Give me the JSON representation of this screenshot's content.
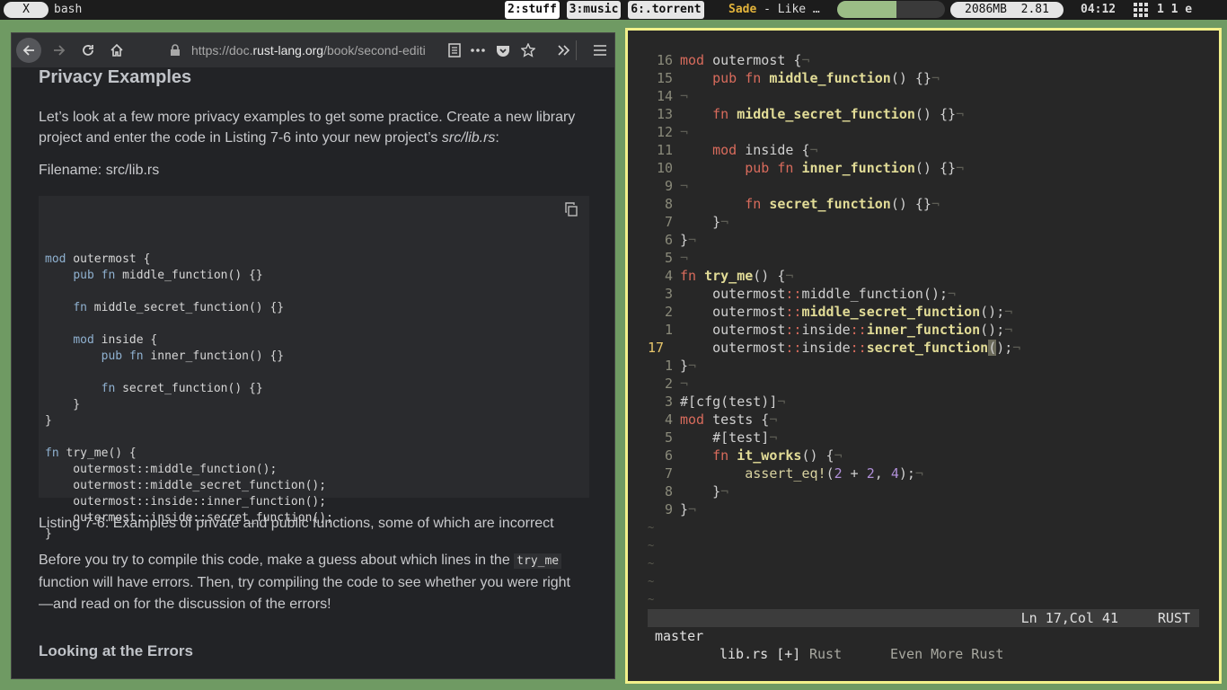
{
  "topbar": {
    "close_label": "X",
    "terminal_title": "bash",
    "workspaces": [
      {
        "label": "2:stuff"
      },
      {
        "label": "3:music"
      },
      {
        "label": "6:.torrent"
      }
    ],
    "music_artist": "Sade",
    "music_track": "- Like …",
    "music_progress": 0.55,
    "memory": "2086MB",
    "load": "2.81",
    "clock": "04:12",
    "tags": "1 1 e"
  },
  "browser": {
    "url_prefix": "https://doc.",
    "url_domain": "rust-lang.org",
    "url_path": "/book/second-editi",
    "heading": "Privacy Examples",
    "intro_text": "Let’s look at a few more privacy examples to get some practice. Create a new library project and enter the code in Listing 7-6 into your new project’s ",
    "intro_file": "src/lib.rs",
    "intro_end": ":",
    "filename_label": "Filename: src/lib.rs",
    "code_lines": [
      "mod outermost {",
      "    pub fn middle_function() {}",
      "",
      "    fn middle_secret_function() {}",
      "",
      "    mod inside {",
      "        pub fn inner_function() {}",
      "",
      "        fn secret_function() {}",
      "    }",
      "}",
      "",
      "fn try_me() {",
      "    outermost::middle_function();",
      "    outermost::middle_secret_function();",
      "    outermost::inside::inner_function();",
      "    outermost::inside::secret_function();",
      "}"
    ],
    "caption": "Listing 7-6: Examples of private and public functions, some of which are incorrect",
    "before_1": "Before you try to compile this code, make a guess about which lines in the ",
    "before_code": "try_me",
    "before_2": " function will have errors. Then, try compiling the code to see whether you were right—and read on for the discussion of the errors!",
    "heading2": "Looking at the Errors"
  },
  "editor": {
    "lines": [
      {
        "ln": "16",
        "html": "<span class='e-kw'>mod</span> outermost {"
      },
      {
        "ln": "15",
        "html": "    <span class='e-kw'>pub fn</span> <span class='e-fn'>middle_function</span>() {}"
      },
      {
        "ln": "14",
        "html": ""
      },
      {
        "ln": "13",
        "html": "    <span class='e-kw'>fn</span> <span class='e-fn'>middle_secret_function</span>() {}"
      },
      {
        "ln": "12",
        "html": ""
      },
      {
        "ln": "11",
        "html": "    <span class='e-kw'>mod</span> inside {"
      },
      {
        "ln": "10",
        "html": "        <span class='e-kw'>pub fn</span> <span class='e-fn'>inner_function</span>() {}"
      },
      {
        "ln": "9",
        "html": ""
      },
      {
        "ln": "8",
        "html": "        <span class='e-kw'>fn</span> <span class='e-fn'>secret_function</span>() {}"
      },
      {
        "ln": "7",
        "html": "    }"
      },
      {
        "ln": "6",
        "html": "}"
      },
      {
        "ln": "5",
        "html": ""
      },
      {
        "ln": "4",
        "html": "<span class='e-kw'>fn</span> <span class='e-fn'>try_me</span>() {"
      },
      {
        "ln": "3",
        "html": "    outermost<span class='e-op'>::</span>middle_function();"
      },
      {
        "ln": "2",
        "html": "    outermost<span class='e-op'>::</span><span class='e-fn'>middle_secret_function</span>();"
      },
      {
        "ln": "1",
        "html": "    outermost<span class='e-op'>::</span>inside<span class='e-op'>::</span><span class='e-fn'>inner_function</span>();"
      },
      {
        "ln": "17",
        "cur": true,
        "html": "    outermost<span class='e-op'>::</span>inside<span class='e-op'>::</span><span class='e-fn'>secret_function</span><span class='cursor'>(</span>);"
      },
      {
        "ln": "1",
        "html": "}"
      },
      {
        "ln": "2",
        "html": ""
      },
      {
        "ln": "3",
        "html": "#[cfg(test)]"
      },
      {
        "ln": "4",
        "html": "<span class='e-kw'>mod</span> tests {"
      },
      {
        "ln": "5",
        "html": "    #[test]"
      },
      {
        "ln": "6",
        "html": "    <span class='e-kw'>fn</span> <span class='e-fn'>it_works</span>() {"
      },
      {
        "ln": "7",
        "html": "        <span class='e-mac'>assert_eq!</span>(<span class='e-num'>2</span> + <span class='e-num'>2</span>, <span class='e-num'>4</span>);"
      },
      {
        "ln": "8",
        "html": "    }"
      },
      {
        "ln": "9",
        "html": "}"
      }
    ],
    "status_branch": "master",
    "status_file": "lib.rs [+]",
    "status_position": "Ln 17,Col 41",
    "status_lang": "RUST",
    "tab_1": "Rust",
    "tab_2": "Even More Rust"
  }
}
